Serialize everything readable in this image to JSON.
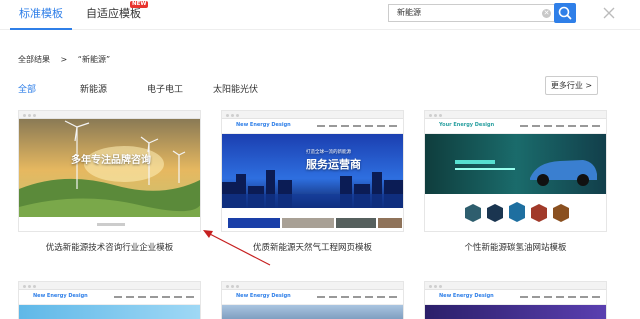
{
  "tabs": {
    "standard": "标准模板",
    "adaptive": "自适应模板",
    "new_badge": "NEW"
  },
  "search": {
    "value": "新能源",
    "clear_icon": "✕"
  },
  "breadcrumb": {
    "all": "全部结果",
    "sep": ">",
    "term": "“新能源”"
  },
  "filters": [
    "全部",
    "新能源",
    "电子电工",
    "太阳能光伏"
  ],
  "more": "更多行业 >",
  "cards": [
    {
      "title": "优选新能源技术咨询行业企业模板",
      "hero": "多年专注品牌咨询"
    },
    {
      "title": "优质新能源天然气工程网页模板",
      "logo": "New Energy Design",
      "hero": "服务运营商",
      "hero_sub": "打造全球一流的新能源"
    },
    {
      "title": "个性新能源碳氢油网站模板",
      "logo": "Your Energy Design"
    },
    {
      "logo": "New Energy Design"
    },
    {
      "logo": "New Energy Design"
    },
    {
      "logo": "New Energy Design"
    }
  ],
  "colors": {
    "accent": "#2f7fe8",
    "arrow": "#c62020",
    "badge": "#e8352e"
  }
}
